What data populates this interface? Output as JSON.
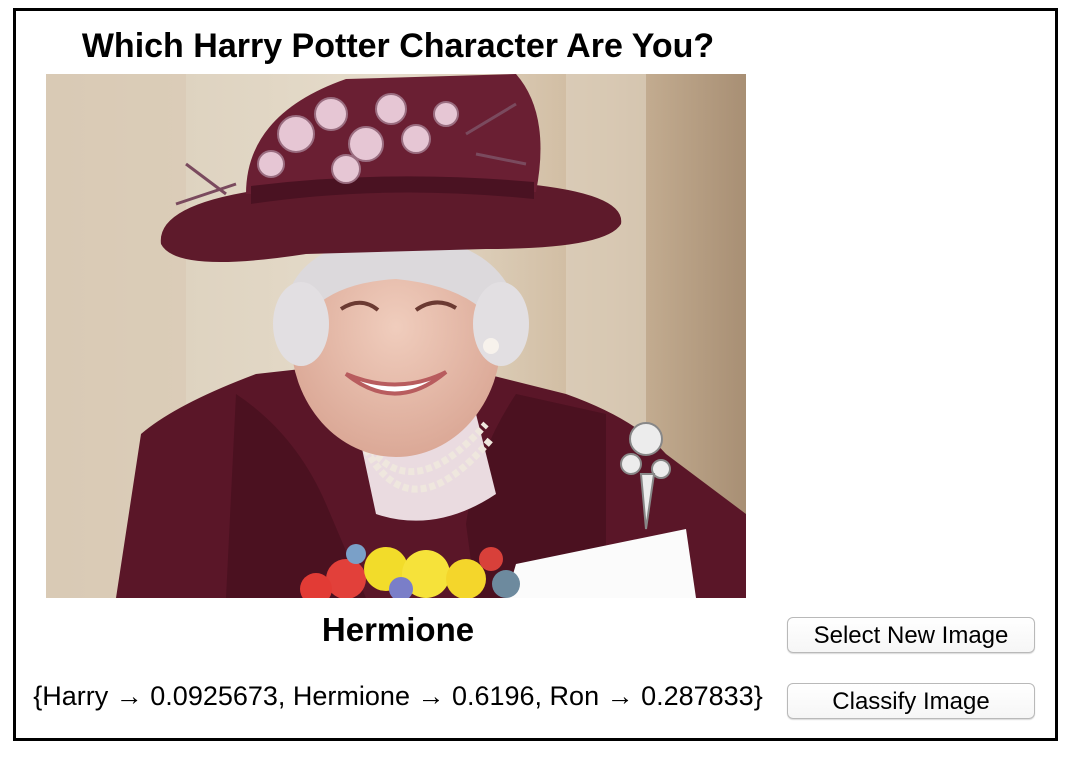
{
  "app": {
    "title": "Which Harry Potter Character Are You?",
    "prediction": "Hermione",
    "probabilities": "{Harry → 0.0925673, Hermione → 0.6196, Ron → 0.287833}",
    "buttons": {
      "select_label": "Select New Image",
      "classify_label": "Classify Image"
    }
  },
  "photo": {
    "subject": "portrait-photo"
  },
  "colors": {
    "frame": "#000000",
    "hat_and_coat": "#5e1a2b",
    "background": "#ffffff"
  }
}
